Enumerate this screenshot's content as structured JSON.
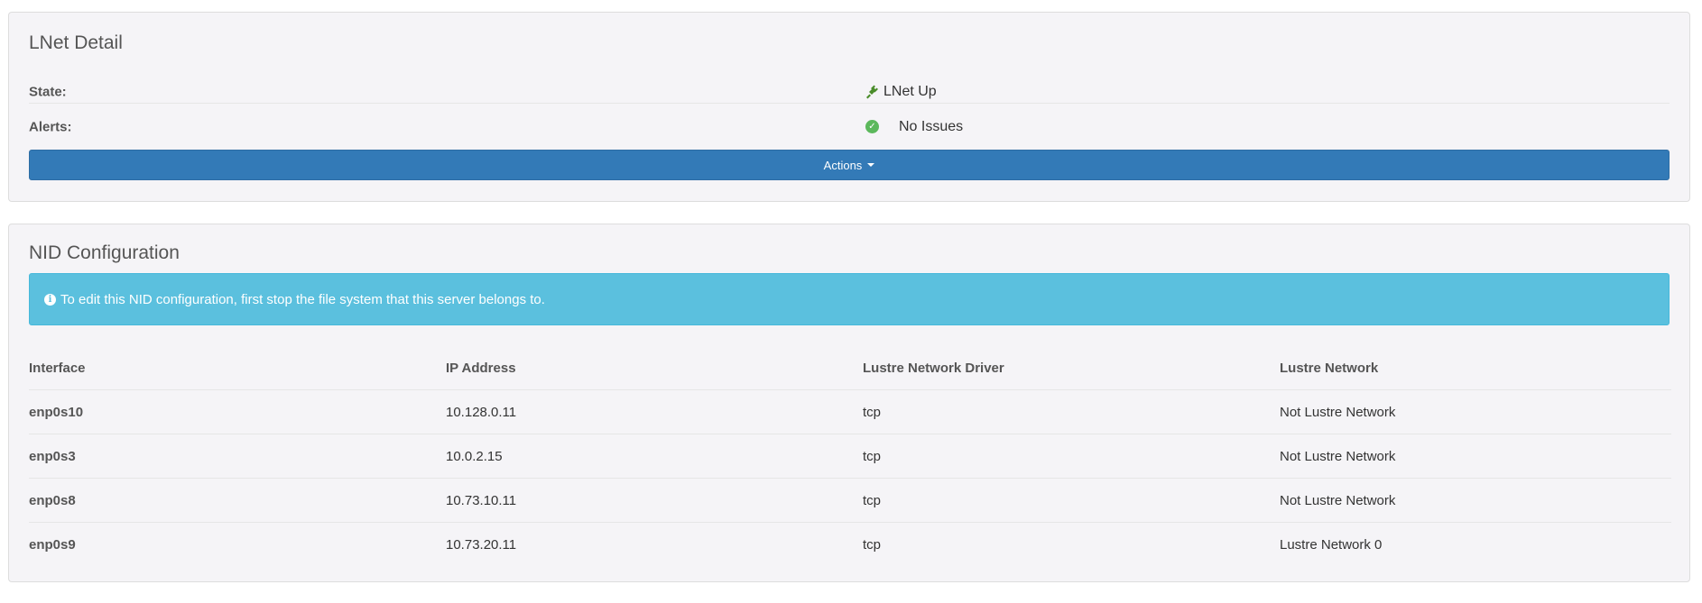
{
  "lnet_detail": {
    "title": "LNet Detail",
    "state_label": "State:",
    "state_value": "LNet Up",
    "state_icon": "plug-icon",
    "alerts_label": "Alerts:",
    "alerts_value": "No Issues",
    "alerts_icon": "check-circle-icon",
    "actions_label": "Actions"
  },
  "nid_configuration": {
    "title": "NID Configuration",
    "info_message": "To edit this NID configuration, first stop the file system that this server belongs to.",
    "columns": [
      "Interface",
      "IP Address",
      "Lustre Network Driver",
      "Lustre Network"
    ],
    "rows": [
      {
        "interface": "enp0s10",
        "ip": "10.128.0.11",
        "driver": "tcp",
        "network": "Not Lustre Network"
      },
      {
        "interface": "enp0s3",
        "ip": "10.0.2.15",
        "driver": "tcp",
        "network": "Not Lustre Network"
      },
      {
        "interface": "enp0s8",
        "ip": "10.73.10.11",
        "driver": "tcp",
        "network": "Not Lustre Network"
      },
      {
        "interface": "enp0s9",
        "ip": "10.73.20.11",
        "driver": "tcp",
        "network": "Lustre Network 0"
      }
    ]
  },
  "colors": {
    "primary": "#337ab7",
    "info": "#5bc0de",
    "success": "#5cb85c",
    "plug": "#4a8c2a"
  }
}
